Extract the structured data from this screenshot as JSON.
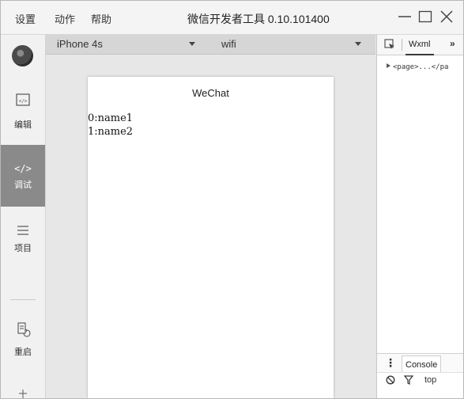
{
  "menu": {
    "settings": "设置",
    "actions": "动作",
    "help": "帮助"
  },
  "window": {
    "title": "微信开发者工具 0.10.101400",
    "controls": [
      "minimize-icon",
      "maximize-icon",
      "close-icon"
    ]
  },
  "sidebar": {
    "items": [
      {
        "label": "编辑",
        "icon": "code-file-icon"
      },
      {
        "label": "调试",
        "icon": "code-brackets-icon",
        "active": true
      },
      {
        "label": "项目",
        "icon": "menu-lines-icon"
      },
      {
        "label": "重启",
        "icon": "restart-icon"
      }
    ]
  },
  "simulator": {
    "device": "iPhone 4s",
    "network": "wifi",
    "nav_title": "WeChat",
    "rows": [
      "0:name1",
      "1:name2"
    ]
  },
  "devtools": {
    "tab_wxml": "Wxml",
    "more": "»",
    "tree_node": "<page>...</pa",
    "console_tab": "Console",
    "context": "top"
  },
  "colors": {
    "sidebar_active": "#8a8a8a",
    "frame_bg": "#e7e7e7",
    "titlebar_bg": "#f4f4f4"
  }
}
